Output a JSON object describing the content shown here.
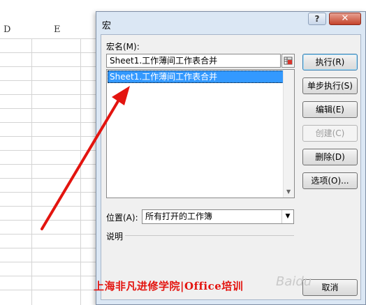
{
  "sheet": {
    "columns": [
      "D",
      "E"
    ]
  },
  "dialog": {
    "title": "宏",
    "help_button": "?",
    "close_button": "✕",
    "macro_name_label": "宏名(M):",
    "macro_name_value": "Sheet1.工作薄间工作表合并",
    "macro_list": [
      "Sheet1.工作薄间工作表合并"
    ],
    "buttons": {
      "run": "执行(R)",
      "step": "单步执行(S)",
      "edit": "编辑(E)",
      "create": "创建(C)",
      "delete": "删除(D)",
      "options": "选项(O)..."
    },
    "location_label": "位置(A):",
    "location_value": "所有打开的工作簿",
    "description_label": "说明",
    "cancel": "取消"
  },
  "overlay": {
    "caption": "上海非凡进修学院|Office培训",
    "watermark": "Baidu"
  },
  "colors": {
    "arrow": "#e3140f",
    "selection": "#3399ff",
    "close": "#c4432b"
  }
}
